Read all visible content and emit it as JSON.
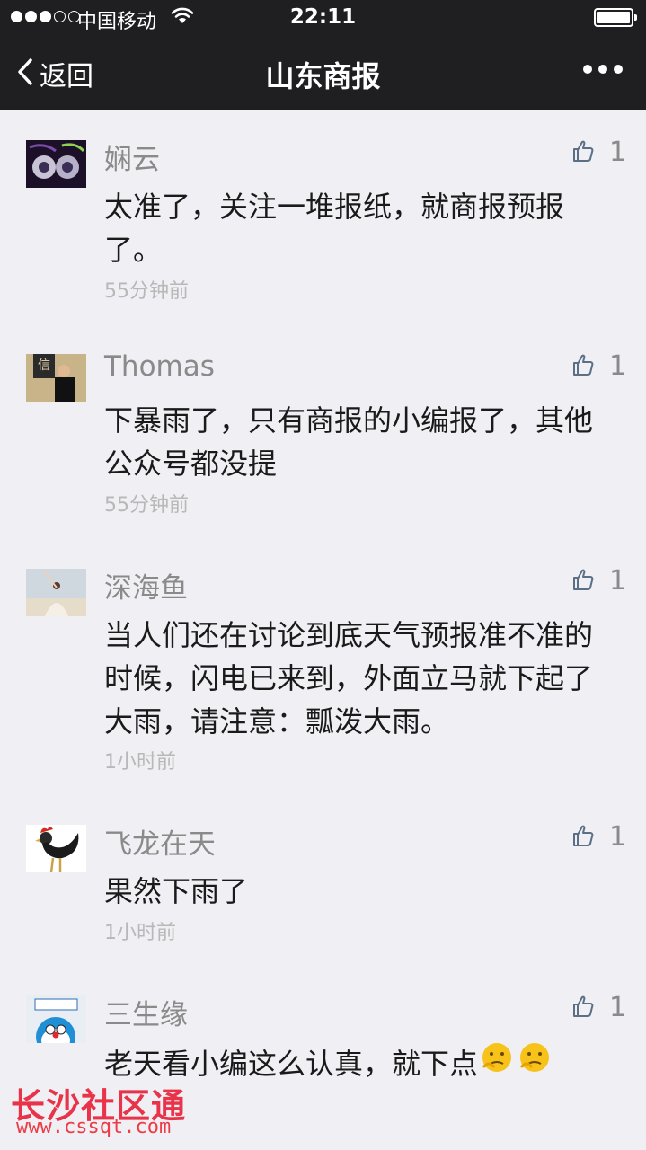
{
  "status_bar": {
    "carrier": "中国移动",
    "time": "22:11",
    "signal_bars_filled": 3,
    "signal_bars_total": 5
  },
  "nav": {
    "back_label": "返回",
    "title": "山东商报"
  },
  "comments": [
    {
      "name": "娴云",
      "text": "太准了，关注一堆报纸，就商报预报了。",
      "likes": "1",
      "time": "55分钟前"
    },
    {
      "name": "Thomas",
      "text": "下暴雨了，只有商报的小编报了，其他公众号都没提",
      "likes": "1",
      "time": "55分钟前"
    },
    {
      "name": "深海鱼",
      "text": "当人们还在讨论到底天气预报准不准的时候，闪电已来到，外面立马就下起了大雨，请注意：瓢泼大雨。",
      "likes": "1",
      "time": "1小时前"
    },
    {
      "name": "飞龙在天",
      "text": "果然下雨了",
      "likes": "1",
      "time": "1小时前"
    },
    {
      "name": "三生缘",
      "text": "老天看小编这么认真，就下点",
      "likes": "1"
    }
  ],
  "watermark": {
    "title": "长沙社区通",
    "url": "www.cssqt.com"
  },
  "colors": {
    "bar_bg": "#1f1f22",
    "page_bg": "#efeff4",
    "name_gray": "#8a8a8a",
    "time_gray": "#b8b8b8",
    "thumb_blue": "#5b6f86",
    "watermark_red": "#e8243b"
  }
}
